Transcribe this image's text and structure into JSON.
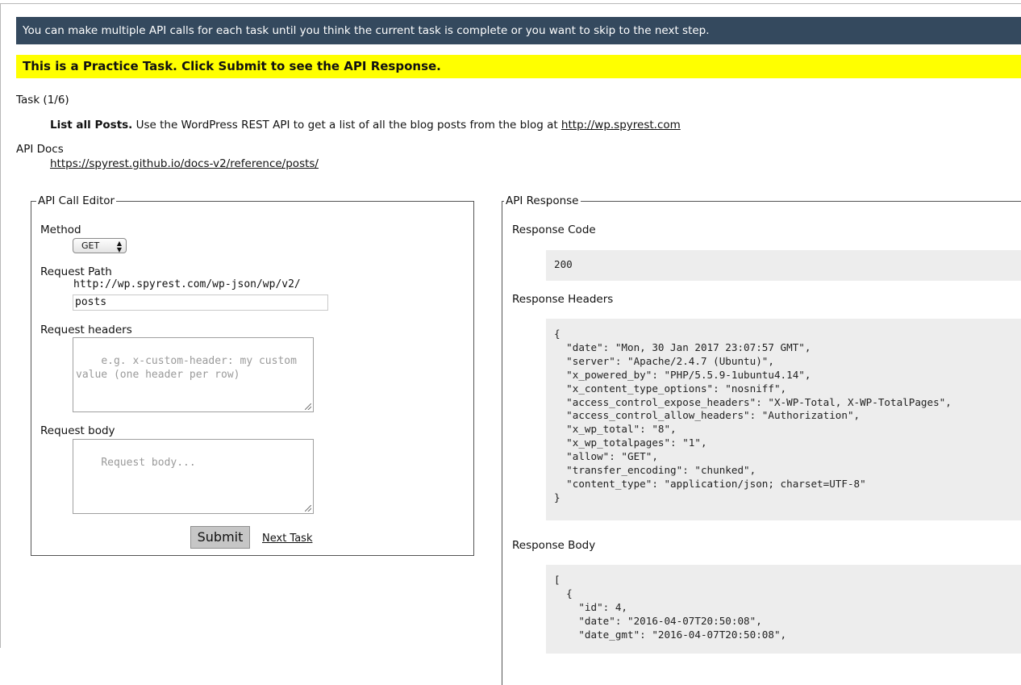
{
  "banner": {
    "info": "You can make multiple API calls for each task until you think the current task is complete or you want to skip to the next step.",
    "practice": "This is a Practice Task. Click Submit to see the API Response."
  },
  "task": {
    "counter": "Task (1/6)",
    "title": "List all Posts.",
    "description": " Use the WordPress REST API to get a list of all the blog posts from the blog at ",
    "link": "http://wp.spyrest.com"
  },
  "docs": {
    "label": "API Docs",
    "link": "https://spyrest.github.io/docs-v2/reference/posts/"
  },
  "editor": {
    "legend": "API Call Editor",
    "method_label": "Method",
    "method_value": "GET",
    "path_label": "Request Path",
    "path_prefix": "http://wp.spyrest.com/wp-json/wp/v2/",
    "path_value": "posts",
    "headers_label": "Request headers",
    "headers_placeholder": "e.g. x-custom-header: my custom value (one header per row)",
    "body_label": "Request body",
    "body_placeholder": "Request body...",
    "submit_label": "Submit",
    "next_label": "Next Task"
  },
  "response": {
    "legend": "API Response",
    "code_label": "Response Code",
    "code_value": "200",
    "headers_label": "Response Headers",
    "headers_json": "{\n  \"date\": \"Mon, 30 Jan 2017 23:07:57 GMT\",\n  \"server\": \"Apache/2.4.7 (Ubuntu)\",\n  \"x_powered_by\": \"PHP/5.5.9-1ubuntu4.14\",\n  \"x_content_type_options\": \"nosniff\",\n  \"access_control_expose_headers\": \"X-WP-Total, X-WP-TotalPages\",\n  \"access_control_allow_headers\": \"Authorization\",\n  \"x_wp_total\": \"8\",\n  \"x_wp_totalpages\": \"1\",\n  \"allow\": \"GET\",\n  \"transfer_encoding\": \"chunked\",\n  \"content_type\": \"application/json; charset=UTF-8\"\n}",
    "body_label": "Response Body",
    "body_json": "[\n  {\n    \"id\": 4,\n    \"date\": \"2016-04-07T20:50:08\",\n    \"date_gmt\": \"2016-04-07T20:50:08\","
  }
}
